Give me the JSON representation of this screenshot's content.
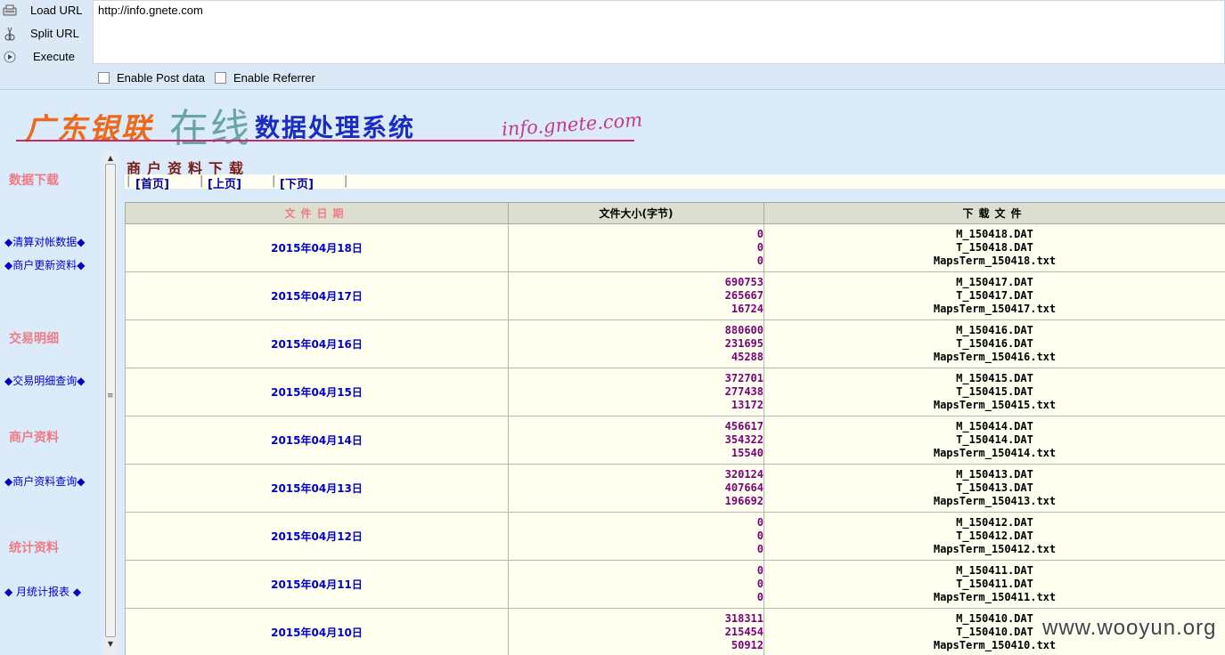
{
  "hackbar": {
    "load_label": "Load URL",
    "split_label": "Split URL",
    "execute_label": "Execute",
    "url_value": "http://info.gnete.com",
    "post_label": "Enable Post data",
    "referrer_label": "Enable Referrer"
  },
  "banner": {
    "part1": "广东银联",
    "part2": "在线",
    "part3": "数据处理系统",
    "domain": "info.gnete.com"
  },
  "sidebar": {
    "sections": [
      {
        "title": "数据下载",
        "links": [
          "◆清算对帐数据◆",
          "◆商户更新资料◆"
        ]
      },
      {
        "title": "交易明细",
        "links": [
          "◆交易明细查询◆"
        ]
      },
      {
        "title": "商户资料",
        "links": [
          "◆商户资料查询◆"
        ]
      },
      {
        "title": "统计资料",
        "links": [
          "◆ 月统计报表 ◆"
        ]
      }
    ]
  },
  "main": {
    "title": "商户资料下载",
    "pager": {
      "first": "[首页]",
      "prev": "[上页]",
      "next": "[下页]"
    },
    "headers": [
      "文件日期",
      "文件大小(字节)",
      "下载文件"
    ],
    "rows": [
      {
        "date": "2015年04月18日",
        "sizes": [
          "0",
          "0",
          "0"
        ],
        "files": [
          "M_150418.DAT",
          "T_150418.DAT",
          "MapsTerm_150418.txt"
        ]
      },
      {
        "date": "2015年04月17日",
        "sizes": [
          "690753",
          "265667",
          "16724"
        ],
        "files": [
          "M_150417.DAT",
          "T_150417.DAT",
          "MapsTerm_150417.txt"
        ]
      },
      {
        "date": "2015年04月16日",
        "sizes": [
          "880600",
          "231695",
          "45288"
        ],
        "files": [
          "M_150416.DAT",
          "T_150416.DAT",
          "MapsTerm_150416.txt"
        ]
      },
      {
        "date": "2015年04月15日",
        "sizes": [
          "372701",
          "277438",
          "13172"
        ],
        "files": [
          "M_150415.DAT",
          "T_150415.DAT",
          "MapsTerm_150415.txt"
        ]
      },
      {
        "date": "2015年04月14日",
        "sizes": [
          "456617",
          "354322",
          "15540"
        ],
        "files": [
          "M_150414.DAT",
          "T_150414.DAT",
          "MapsTerm_150414.txt"
        ]
      },
      {
        "date": "2015年04月13日",
        "sizes": [
          "320124",
          "407664",
          "196692"
        ],
        "files": [
          "M_150413.DAT",
          "T_150413.DAT",
          "MapsTerm_150413.txt"
        ]
      },
      {
        "date": "2015年04月12日",
        "sizes": [
          "0",
          "0",
          "0"
        ],
        "files": [
          "M_150412.DAT",
          "T_150412.DAT",
          "MapsTerm_150412.txt"
        ]
      },
      {
        "date": "2015年04月11日",
        "sizes": [
          "0",
          "0",
          "0"
        ],
        "files": [
          "M_150411.DAT",
          "T_150411.DAT",
          "MapsTerm_150411.txt"
        ]
      },
      {
        "date": "2015年04月10日",
        "sizes": [
          "318311",
          "215454",
          "50912"
        ],
        "files": [
          "M_150410.DAT",
          "T_150410.DAT",
          "MapsTerm_150410.txt"
        ]
      }
    ]
  },
  "watermark": "www.wooyun.org"
}
